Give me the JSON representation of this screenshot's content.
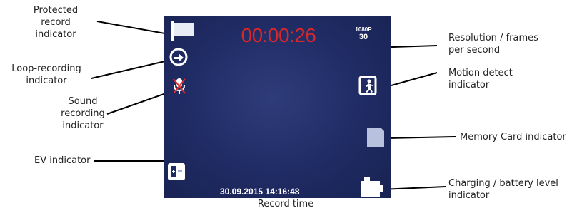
{
  "screen": {
    "record_time": "00:00:26",
    "resolution_top": "1080P",
    "resolution_bottom": "30",
    "datetime": "30.09.2015 14:16:48"
  },
  "labels": {
    "protected": [
      "Protected",
      "record",
      "indicator"
    ],
    "loop": [
      "Loop-recording",
      "indicator"
    ],
    "sound": [
      "Sound",
      "recording",
      "indicator"
    ],
    "ev": "EV indicator",
    "record_time": "Record time",
    "resolution": [
      "Resolution / frames",
      "per second"
    ],
    "motion": [
      "Motion detect",
      "indicator"
    ],
    "memory": "Memory Card indicator",
    "charging": [
      "Charging / battery level",
      "indicator"
    ]
  },
  "icons": {
    "protected": "flag-icon",
    "loop": "loop-icon",
    "sound": "microphone-muted-icon",
    "ev": "ev-icon",
    "motion": "motion-detect-icon",
    "memory": "memory-card-icon",
    "battery": "charging-battery-icon"
  },
  "colors": {
    "screen_bg": "#1f2b63",
    "record_time": "#d8262a",
    "overlay_text": "#ffffff",
    "leader_line": "#000000"
  }
}
